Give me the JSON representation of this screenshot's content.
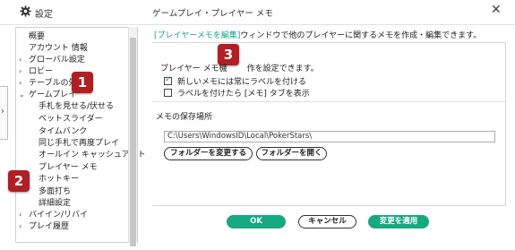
{
  "window": {
    "title": "設定",
    "header_title": "ゲームプレイ・プレイヤー メモ",
    "close_symbol": "✕"
  },
  "sidebar": {
    "items": [
      {
        "label": "概要",
        "arrow": ""
      },
      {
        "label": "アカウント 情報",
        "arrow": ""
      },
      {
        "label": "グローバル設定",
        "arrow": "›"
      },
      {
        "label": "ロビー",
        "arrow": "›"
      },
      {
        "label": "テーブルの外",
        "arrow": "›"
      },
      {
        "label": "ゲームプレイ",
        "arrow": "⌄"
      },
      {
        "label": "手札を見せる/伏せる",
        "arrow": ""
      },
      {
        "label": "ベットスライダー",
        "arrow": ""
      },
      {
        "label": "タイムバンク",
        "arrow": ""
      },
      {
        "label": "同じ手札で再度プレイ",
        "arrow": ""
      },
      {
        "label": "オールイン キャッシュアウト",
        "arrow": ""
      },
      {
        "label": "プレイヤー メモ",
        "arrow": ""
      },
      {
        "label": "ホットキー",
        "arrow": ""
      },
      {
        "label": "多面打ち",
        "arrow": ""
      },
      {
        "label": "詳細設定",
        "arrow": ""
      },
      {
        "label": "バイイン/リバイ",
        "arrow": "›"
      },
      {
        "label": "プレイ履歴",
        "arrow": "›"
      }
    ]
  },
  "badges": [
    "1",
    "2",
    "3"
  ],
  "main": {
    "desc_link": "[プレイヤーメモを編集]",
    "desc_rest": "ウィンドウで他のプレイヤーに関するメモを作成・編集できます。",
    "section1_title_a": "プレイヤー メモ機",
    "section1_title_b": "作を設定できます。",
    "checkbox1_label": "新しいメモには常にラベルを付ける",
    "checkbox1_checked": true,
    "checkbox2_label": "ラベルを付けたら [メモ] タブを表示",
    "checkbox2_checked": false,
    "section2_title": "メモの保存場所",
    "path_value": "C:\\Users\\WindowsID\\Local\\PokerStars\\",
    "change_folder_button": "フォルダーを変更する",
    "open_folder_button": "フォルダーを開く"
  },
  "footer": {
    "ok_button": "OK",
    "cancel_button": "キャンセル",
    "apply_button": "変更を適用"
  },
  "colors": {
    "accent_green": "#16a881",
    "link_teal": "#19a08e",
    "badge_red": "#b11e23"
  }
}
